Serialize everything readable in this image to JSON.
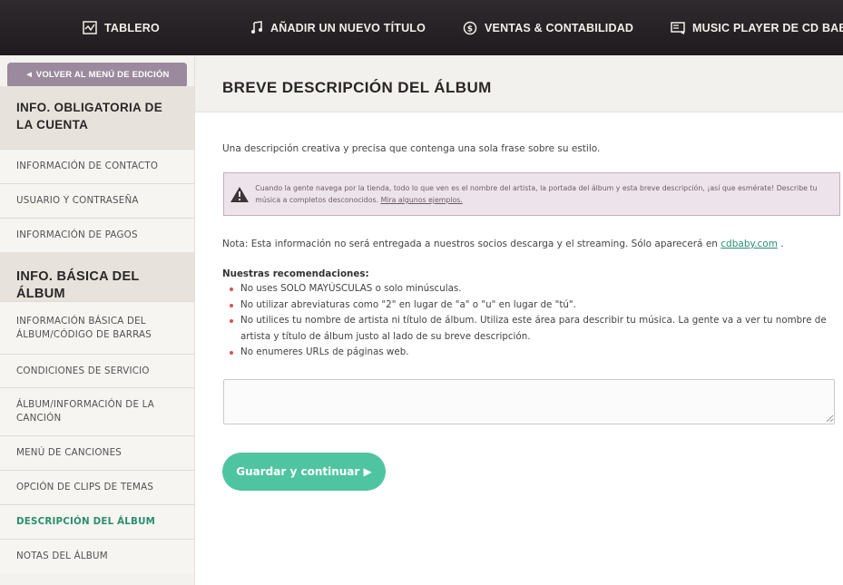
{
  "nav": {
    "items": [
      {
        "label": "TABLERO",
        "icon": "dashboard-icon"
      },
      {
        "label": "AÑADIR UN NUEVO TÍTULO",
        "icon": "music-note-icon"
      },
      {
        "label": "VENTAS & CONTABILIDAD",
        "icon": "dollar-icon"
      },
      {
        "label": "MUSIC PLAYER DE CD BABY",
        "icon": "player-icon"
      }
    ]
  },
  "sidebar": {
    "back_label": "◄ VOLVER AL MENÚ DE EDICIÓN",
    "section1_title": "INFO. OBLIGATORIA DE LA CUENTA",
    "section1_items": [
      "INFORMACIÓN DE CONTACTO",
      "USUARIO Y CONTRASEÑA",
      "INFORMACIÓN DE PAGOS"
    ],
    "section2_title": "INFO. BÁSICA DEL ÁLBUM",
    "section2_items": [
      "INFORMACIÓN BÁSICA DEL ÁLBUM/CÓDIGO DE BARRAS",
      "CONDICIONES DE SERVICIO",
      "ÁLBUM/INFORMACIÓN DE LA CANCIÓN",
      "MENÚ DE CANCIONES",
      "OPCIÓN DE CLIPS DE TEMAS",
      "DESCRIPCIÓN DEL ÁLBUM",
      "NOTAS DEL ÁLBUM"
    ],
    "active_item": "DESCRIPCIÓN DEL ÁLBUM"
  },
  "main": {
    "title": "BREVE DESCRIPCIÓN DEL ÁLBUM",
    "intro": "Una descripción creativa y precisa que contenga una sola frase sobre su estilo.",
    "warning_text": "Cuando la gente navega por la tienda, todo lo que ven es el nombre del artista, la portada del álbum y esta breve descripción, ¡así que esmérate! Describe tu música a completos desconocidos.",
    "warning_link": "Mira algunos ejemplos.",
    "note_prefix": "Nota: Esta información no será entregada a nuestros socios descarga y el streaming. Sólo aparecerá en ",
    "note_link": "cdbaby.com",
    "note_suffix": " .",
    "recs_title": "Nuestras recomendaciones:",
    "recs": [
      "No uses SOLO MAYÚSCULAS o solo minúsculas.",
      "No utilizar abreviaturas como \"2\" en lugar de \"a\" o \"u\" en lugar de \"tú\".",
      "No utilices tu nombre de artista ni título de álbum. Utiliza este área para describir tu música. La gente va a ver tu nombre de artista y título de álbum justo al lado de su breve descripción.",
      "No enumeres URLs de páginas web."
    ],
    "description_value": "",
    "save_label": "Guardar y continuar ▶"
  },
  "colors": {
    "nav_bg": "#2a2528",
    "back_button": "#9b8a9d",
    "active_green": "#2a8f6d",
    "save_button": "#4fc4a0",
    "warning_bg": "#ece4ea"
  }
}
